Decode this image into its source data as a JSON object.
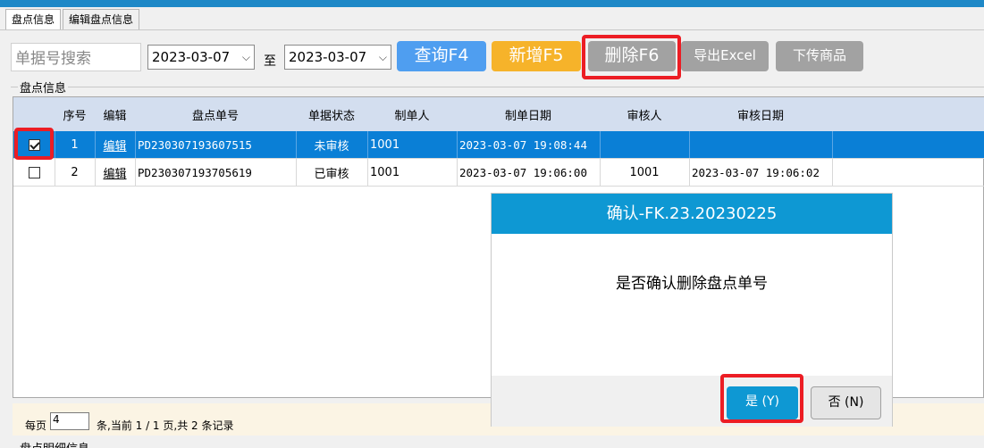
{
  "tabs": [
    {
      "label": "盘点信息"
    },
    {
      "label": "编辑盘点信息"
    }
  ],
  "toolbar": {
    "search_placeholder": "单据号搜索",
    "date_from": "2023-03-07",
    "date_to": "2023-03-07",
    "to_label": "至",
    "query_label": "查询F4",
    "add_label": "新增F5",
    "delete_label": "删除F6",
    "export_label": "导出Excel",
    "upload_label": "下传商品"
  },
  "section_title": "盘点信息",
  "grid": {
    "columns": [
      "序号",
      "编辑",
      "盘点单号",
      "单据状态",
      "制单人",
      "制单日期",
      "审核人",
      "审核日期"
    ],
    "rows": [
      {
        "checked": true,
        "index": "1",
        "edit": "编辑",
        "code": "PD230307193607515",
        "status": "未审核",
        "creator": "1001",
        "created": "2023-03-07 19:08:44",
        "auditor": "",
        "audited": ""
      },
      {
        "checked": false,
        "index": "2",
        "edit": "编辑",
        "code": "PD230307193705619",
        "status": "已审核",
        "creator": "1001",
        "created": "2023-03-07 19:06:00",
        "auditor": "1001",
        "audited": "2023-03-07 19:06:02"
      }
    ]
  },
  "pager": {
    "per_page_label": "每页",
    "per_page_value": "4",
    "summary": "条,当前 1 / 1 页,共 2 条记录"
  },
  "bottom_section_title": "盘点明细信息",
  "dialog": {
    "title": "确认-FK.23.20230225",
    "message": "是否确认删除盘点单号",
    "yes_label": "是 (Y)",
    "no_label": "否 (N)"
  },
  "colors": {
    "accent": "#0e98d3",
    "selected_row": "#0a7fd6",
    "query_button": "#4f9ef0",
    "add_button": "#f6b32a",
    "disabled_button": "#a2a2a2",
    "highlight": "#ec1d24"
  }
}
